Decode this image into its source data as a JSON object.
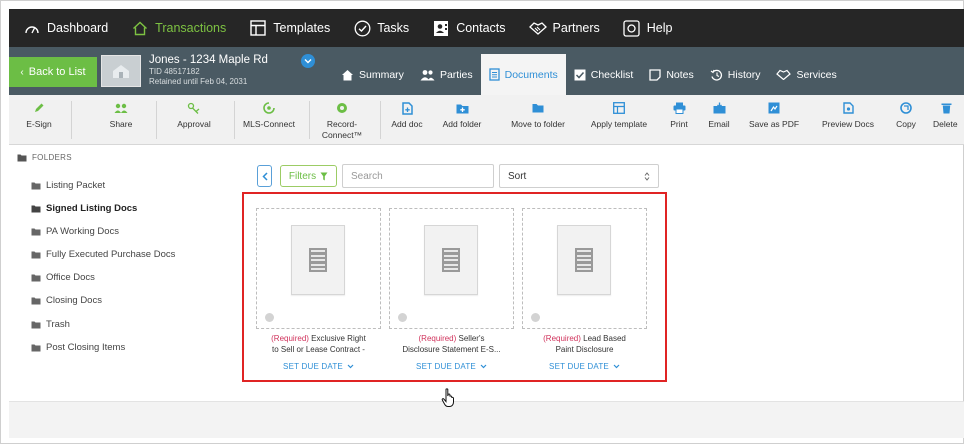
{
  "topnav": {
    "items": [
      {
        "label": "Dashboard",
        "icon": "gauge-icon",
        "active": false
      },
      {
        "label": "Transactions",
        "icon": "home-icon",
        "active": true
      },
      {
        "label": "Templates",
        "icon": "template-icon",
        "active": false
      },
      {
        "label": "Tasks",
        "icon": "check-circle-icon",
        "active": false
      },
      {
        "label": "Contacts",
        "icon": "contact-card-icon",
        "active": false
      },
      {
        "label": "Partners",
        "icon": "handshake-icon",
        "active": false
      },
      {
        "label": "Help",
        "icon": "help-box-icon",
        "active": false
      }
    ]
  },
  "transaction": {
    "back_label": "Back to List",
    "name": "Jones - 1234 Maple Rd",
    "tid": "TID 48517182",
    "retained": "Retained until Feb 04, 2031",
    "tabs": [
      {
        "label": "Summary",
        "icon": "home-icon",
        "active": false
      },
      {
        "label": "Parties",
        "icon": "people-icon",
        "active": false
      },
      {
        "label": "Documents",
        "icon": "document-icon",
        "active": true
      },
      {
        "label": "Checklist",
        "icon": "checklist-icon",
        "active": false
      },
      {
        "label": "Notes",
        "icon": "note-icon",
        "active": false
      },
      {
        "label": "History",
        "icon": "history-icon",
        "active": false
      },
      {
        "label": "Services",
        "icon": "handshake-icon",
        "active": false
      }
    ]
  },
  "toolbar": {
    "esign": "E-Sign",
    "share": "Share",
    "approval": "Approval",
    "mls_connect": "MLS-Connect",
    "record_connect_1": "Record-",
    "record_connect_2": "Connect™",
    "add_doc": "Add doc",
    "add_folder": "Add folder",
    "move_to_folder": "Move to folder",
    "apply_template": "Apply template",
    "print": "Print",
    "email": "Email",
    "save_as_pdf": "Save as PDF",
    "preview_docs": "Preview Docs",
    "copy": "Copy",
    "delete": "Delete"
  },
  "sidebar": {
    "heading": "FOLDERS",
    "folders": [
      {
        "label": "Listing Packet",
        "active": false
      },
      {
        "label": "Signed Listing Docs",
        "active": true
      },
      {
        "label": "PA Working Docs",
        "active": false
      },
      {
        "label": "Fully Executed Purchase Docs",
        "active": false
      },
      {
        "label": "Office Docs",
        "active": false
      },
      {
        "label": "Closing Docs",
        "active": false
      },
      {
        "label": "Trash",
        "active": false
      },
      {
        "label": "Post Closing Items",
        "active": false
      }
    ]
  },
  "filters": {
    "filters_label": "Filters",
    "search_placeholder": "Search",
    "sort_label": "Sort"
  },
  "documents": [
    {
      "required": "(Required)",
      "title_1": " Exclusive Right",
      "title_2": "to Sell or Lease Contract -",
      "due_label": "SET DUE DATE"
    },
    {
      "required": "(Required)",
      "title_1": " Seller's",
      "title_2": "Disclosure Statement E-S...",
      "due_label": "SET DUE DATE"
    },
    {
      "required": "(Required)",
      "title_1": " Lead Based",
      "title_2": "Paint Disclosure",
      "due_label": "SET DUE DATE"
    }
  ],
  "colors": {
    "nav_bg": "#262626",
    "accent_green": "#7dc242",
    "header_bg": "#4a5a63",
    "link_blue": "#2f8fd6",
    "required_red": "#d0335c",
    "highlight_red": "#e02424"
  }
}
